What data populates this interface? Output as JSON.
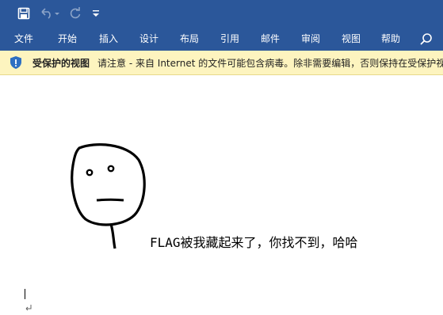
{
  "quick_access": {
    "save_icon": "save-icon",
    "undo_icon": "undo-icon",
    "redo_icon": "redo-icon",
    "customize_icon": "customize-qat-icon"
  },
  "ribbon": {
    "tabs": [
      {
        "label": "文件"
      },
      {
        "label": "开始"
      },
      {
        "label": "插入"
      },
      {
        "label": "设计"
      },
      {
        "label": "布局"
      },
      {
        "label": "引用"
      },
      {
        "label": "邮件"
      },
      {
        "label": "审阅"
      },
      {
        "label": "视图"
      },
      {
        "label": "帮助"
      }
    ],
    "search_icon": "search-icon"
  },
  "protected_view": {
    "title": "受保护的视图",
    "message": "请注意 - 来自 Internet 的文件可能包含病毒。除非需要编辑，否则保持在受保护视图中比较安全。"
  },
  "document": {
    "text": "FLAG被我藏起来了，你找不到，哈哈"
  },
  "colors": {
    "ribbon": "#2b579a",
    "protected_bar": "#fdf4bf",
    "shield": "#2e6fc2"
  }
}
